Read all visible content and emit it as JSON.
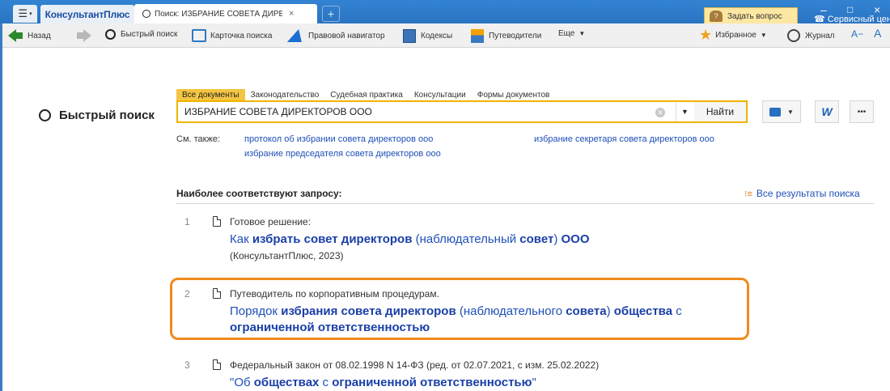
{
  "window": {
    "menu_icon": "hamburger-icon",
    "app_tab": "КонсультантПлюс",
    "doc_tab": "Поиск: ИЗБРАНИЕ СОВЕТА ДИРЕКТОР",
    "close_glyph": "×",
    "new_tab_glyph": "+",
    "ask_button": "Задать вопрос",
    "service_center": "Сервисный цен",
    "controls": [
      "–",
      "□",
      "×"
    ]
  },
  "toolbar": {
    "back": "Назад",
    "quick_search": "Быстрый поиск",
    "search_card": "Карточка поиска",
    "legal_navigator": "Правовой навигатор",
    "codes": "Кодексы",
    "guides": "Путеводители",
    "more": "Еще",
    "favorites": "Избранное",
    "journal": "Журнал",
    "font_smaller": "A−",
    "font_bigger": "A"
  },
  "search": {
    "heading": "Быстрый поиск",
    "filter_tabs": [
      "Все документы",
      "Законодательство",
      "Судебная практика",
      "Консультации",
      "Формы документов"
    ],
    "query": "ИЗБРАНИЕ СОВЕТА ДИРЕКТОРОВ ООО",
    "find_button": "Найти",
    "word_label": "W",
    "more_label": "•••"
  },
  "see_also": {
    "label": "См. также:",
    "links": [
      "протокол об избрании совета директоров ооо",
      "избрание председателя совета директоров ооо",
      "избрание секретаря совета директоров ооо"
    ]
  },
  "results": {
    "header": "Наиболее соответствуют запросу:",
    "all_results": "Все результаты поиска",
    "items": [
      {
        "num": "1",
        "pre": "Готовое решение:",
        "title_parts": [
          "Как ",
          "избрать совет директоров",
          " (наблюдательный ",
          "совет",
          ") ",
          "ООО"
        ],
        "src": "(КонсультантПлюс, 2023)"
      },
      {
        "num": "2",
        "pre": "Путеводитель по корпоративным процедурам.",
        "title_line1": [
          "Порядок ",
          "избрания совета директоров",
          " (наблюдательного ",
          "совета",
          ") ",
          "общества",
          " с"
        ],
        "title_line2": [
          "ограниченной ответственностью"
        ]
      },
      {
        "num": "3",
        "pre": "Федеральный закон от 08.02.1998 N 14-ФЗ (ред. от 02.07.2021, с изм. 25.02.2022)",
        "title_parts": [
          "\"Об ",
          "обществах",
          " с ",
          "ограниченной ответственностью",
          "\""
        ]
      }
    ]
  },
  "colors": {
    "titlebar": "#2b79c9",
    "accent": "#f0b400",
    "link": "#1f4fb8",
    "highlight": "#f08a1c"
  }
}
